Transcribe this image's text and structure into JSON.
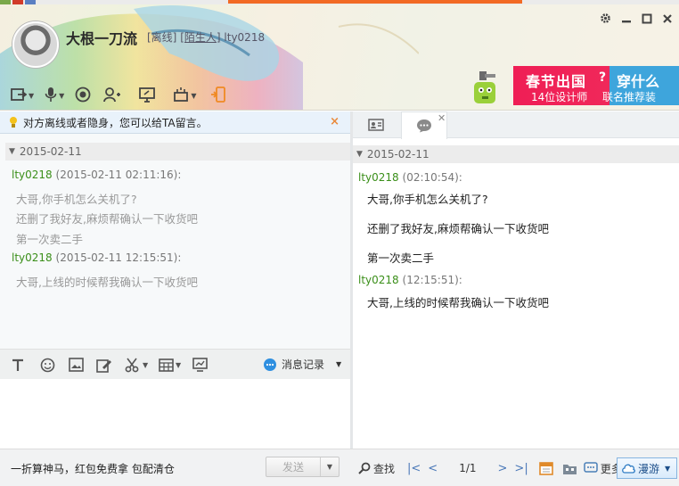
{
  "header": {
    "nickname": "大根一刀流",
    "status": "[离线]",
    "relation": "[陌生人]",
    "account": "lty0218",
    "window_controls": [
      "gear-icon",
      "minimize-icon",
      "maximize-icon",
      "close-icon"
    ],
    "toolbar_icons": [
      "file-transfer-icon",
      "voice-call-icon",
      "video-call-icon",
      "add-friend-icon",
      "screen-share-icon",
      "remote-assist-icon",
      "phone-icon"
    ]
  },
  "ad": {
    "line1": "春节出国",
    "q": "?",
    "line1b": "穿什么",
    "line2": "14位设计师",
    "line2b": "联名推荐装"
  },
  "notice": {
    "text": "对方离线或者隐身，您可以给TA留言。",
    "close": "×"
  },
  "history": {
    "date": "2015-02-11",
    "entries": [
      {
        "sender": "lty0218",
        "time": "(2015-02-11 02:11:16):",
        "messages": [
          "大哥,你手机怎么关机了?",
          "还删了我好友,麻烦帮确认一下收货吧",
          "第一次卖二手"
        ]
      },
      {
        "sender": "lty0218",
        "time": "(2015-02-11 12:15:51):",
        "messages": [
          "大哥,上线的时候帮我确认一下收货吧"
        ]
      }
    ]
  },
  "input_toolbar": {
    "icons": [
      "font-icon",
      "emoji-icon",
      "image-icon",
      "edit-icon",
      "scissors-icon",
      "table-icon",
      "screenshot-icon"
    ],
    "record_label": "消息记录"
  },
  "conversation": {
    "date": "2015-02-11",
    "entries": [
      {
        "sender": "lty0218",
        "time": "(02:10:54):",
        "messages": [
          "大哥,你手机怎么关机了?",
          "还删了我好友,麻烦帮确认一下收货吧",
          "第一次卖二手"
        ]
      },
      {
        "sender": "lty0218",
        "time": "(12:15:51):",
        "messages": [
          "大哥,上线的时候帮我确认一下收货吧"
        ]
      }
    ]
  },
  "bottom": {
    "promo": "一折算神马，红包免费拿 包配清仓",
    "send": "发送",
    "find": "查找",
    "page": "1/1",
    "more": "更多",
    "roam": "漫游"
  },
  "colors": {
    "sender_green": "#3b8f1a",
    "notice_bg": "#e9f2fb",
    "ad_pink": "#ef1e55",
    "ad_blue": "#3ea5dc"
  }
}
